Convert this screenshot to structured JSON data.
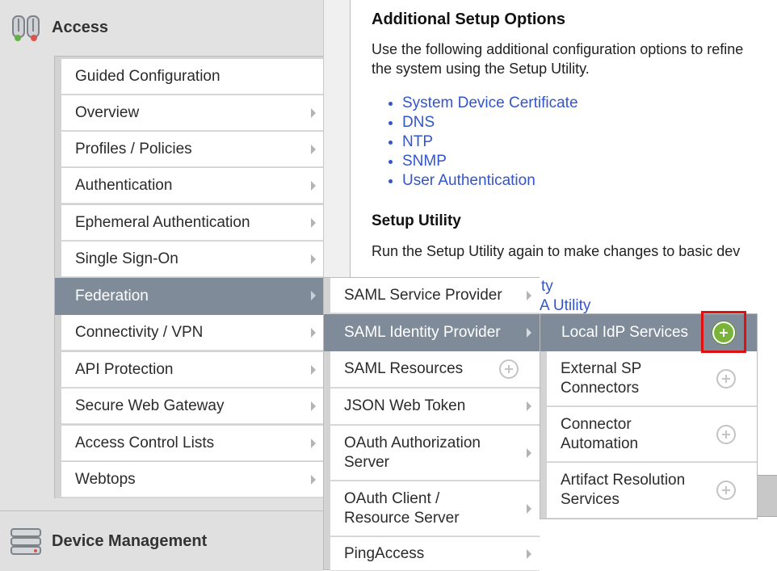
{
  "sidebar": {
    "access_label": "Access",
    "device_label": "Device Management",
    "items": [
      {
        "label": "Guided Configuration",
        "arrow": false
      },
      {
        "label": "Overview",
        "arrow": true
      },
      {
        "label": "Profiles / Policies",
        "arrow": true
      },
      {
        "label": "Authentication",
        "arrow": true
      },
      {
        "label": "Ephemeral Authentication",
        "arrow": true
      },
      {
        "label": "Single Sign-On",
        "arrow": true
      },
      {
        "label": "Federation",
        "arrow": true,
        "active": true
      },
      {
        "label": "Connectivity / VPN",
        "arrow": true
      },
      {
        "label": "API Protection",
        "arrow": true
      },
      {
        "label": "Secure Web Gateway",
        "arrow": true
      },
      {
        "label": "Access Control Lists",
        "arrow": true
      },
      {
        "label": "Webtops",
        "arrow": true
      }
    ]
  },
  "content": {
    "additional_title": "Additional Setup Options",
    "additional_line1": "Use the following additional configuration options to refine",
    "additional_line2": "the system using the Setup Utility.",
    "links": [
      "System Device Certificate",
      "DNS",
      "NTP",
      "SNMP",
      "User Authentication"
    ],
    "setup_title": "Setup Utility",
    "setup_text": "Run the Setup Utility again to make changes to basic dev",
    "partial_link1": "ty",
    "partial_link2": "A Utility"
  },
  "federation_menu": {
    "items": [
      {
        "label": "SAML Service Provider",
        "control": "arrow"
      },
      {
        "label": "SAML Identity Provider",
        "control": "arrow",
        "active": true
      },
      {
        "label": "SAML Resources",
        "control": "plus"
      },
      {
        "label": "JSON Web Token",
        "control": "arrow"
      },
      {
        "label": "OAuth Authorization Server",
        "control": "arrow"
      },
      {
        "label": "OAuth Client / Resource Server",
        "control": "arrow"
      },
      {
        "label": "PingAccess",
        "control": "arrow"
      }
    ]
  },
  "idp_menu": {
    "items": [
      {
        "label": "Local IdP Services",
        "active": true,
        "highlighted": true
      },
      {
        "label": "External SP Connectors"
      },
      {
        "label": "Connector Automation"
      },
      {
        "label": "Artifact Resolution Services"
      }
    ]
  },
  "colors": {
    "active_bg": "#7f8b99",
    "link": "#3355cc",
    "highlight": "#e01010",
    "plus_green": "#7ab33a"
  }
}
